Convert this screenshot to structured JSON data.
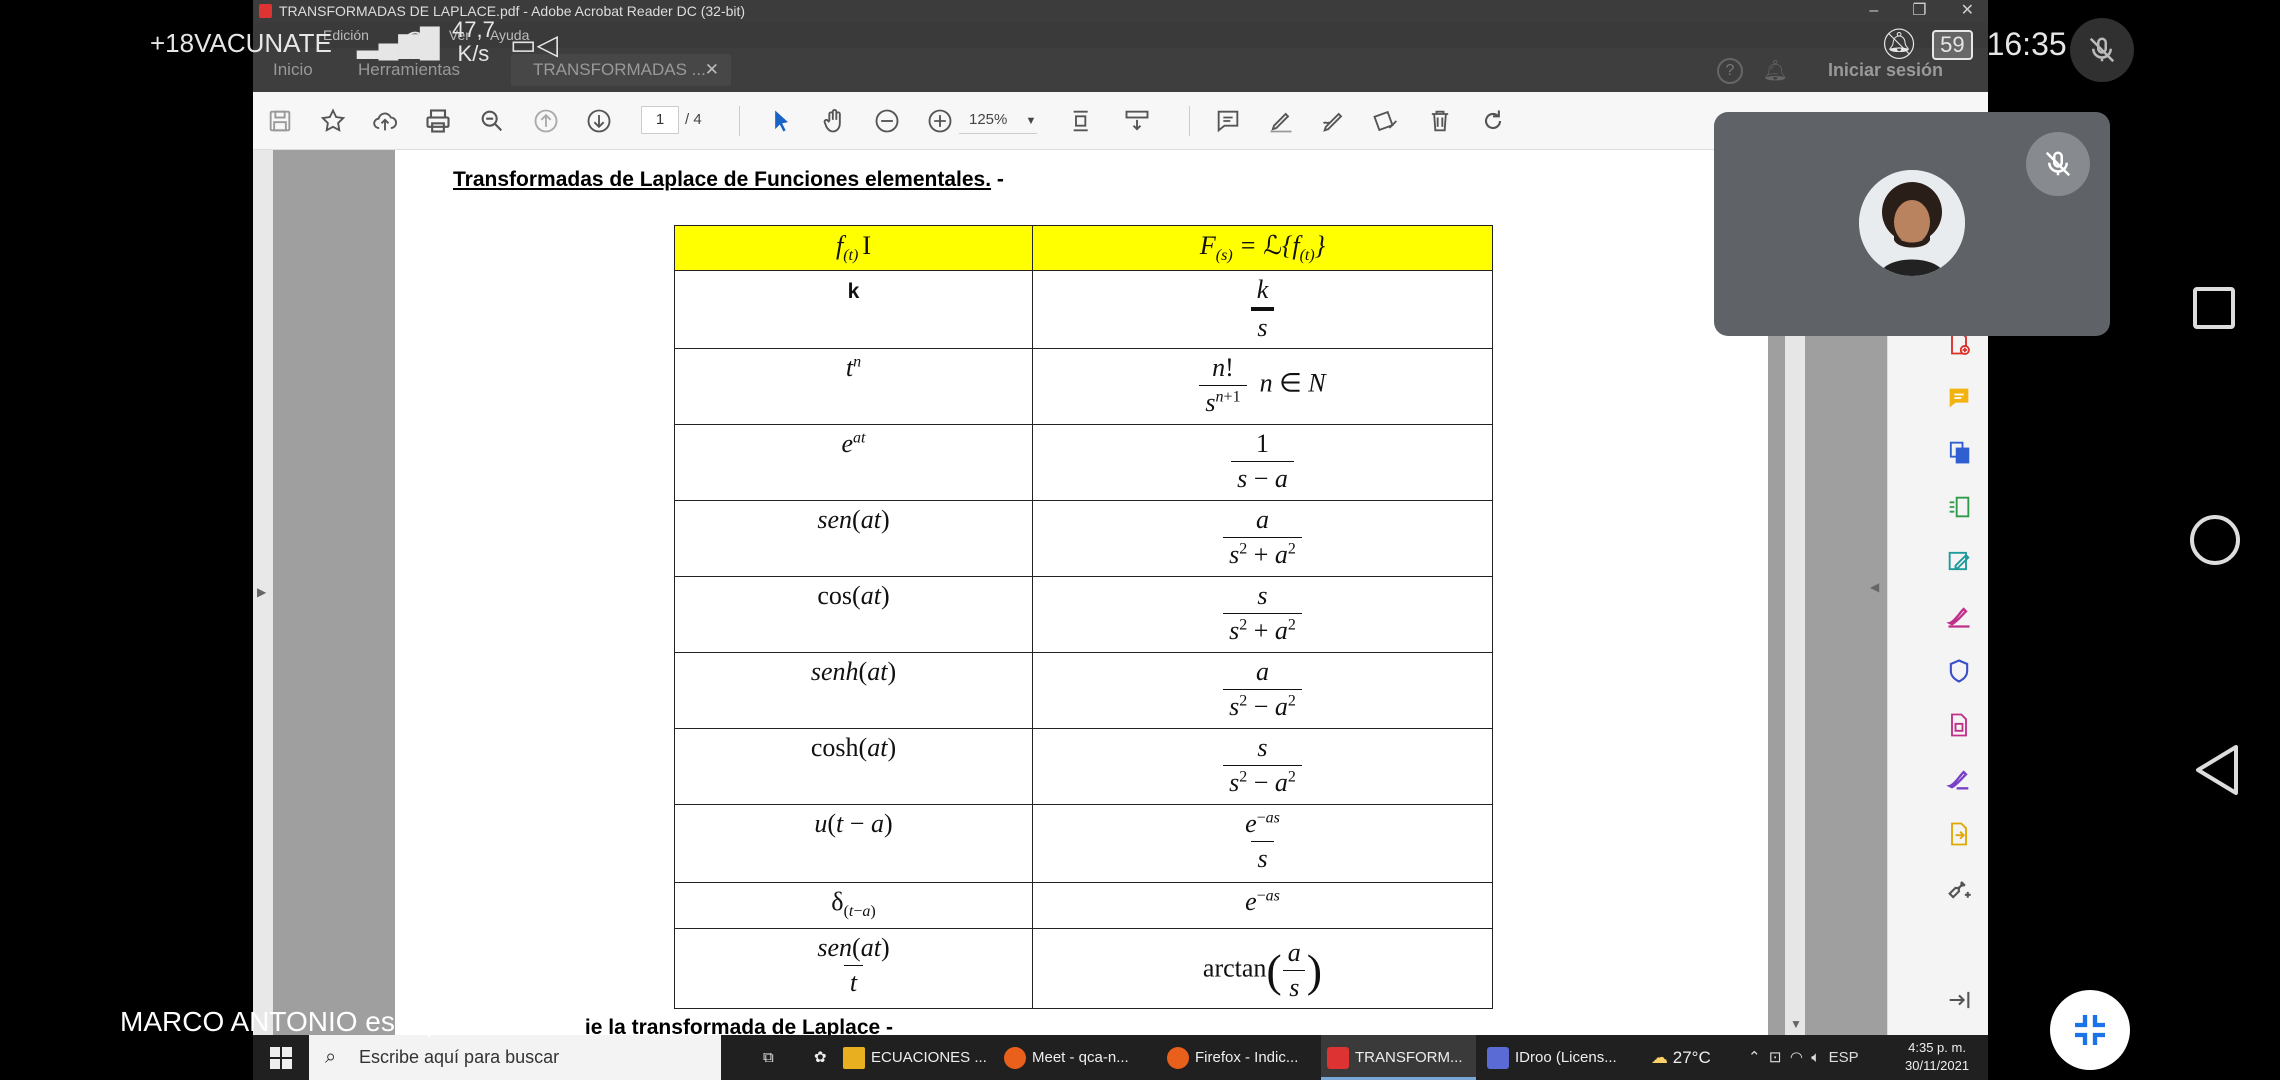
{
  "android": {
    "carrier": "+18VACUNATE",
    "net_speed_value": "47,7",
    "net_speed_unit": "K/s",
    "battery": "59",
    "time": "16:35"
  },
  "acrobat": {
    "window_title": "TRANSFORMADAS DE LAPLACE.pdf - Adobe Acrobat Reader DC (32-bit)",
    "menu": [
      "Edición",
      "Ver",
      "Ayuda"
    ],
    "tabs": {
      "home": "Inicio",
      "tools": "Herramientas",
      "document": "TRANSFORMADAS ..."
    },
    "sign_in": "Iniciar sesión",
    "page_current": "1",
    "page_total": "/ 4",
    "zoom": "125%"
  },
  "document": {
    "heading": "Transformadas de Laplace de Funciones elementales.",
    "heading_suffix": " -",
    "heading2": "ie la transformada de Laplace -",
    "table": {
      "rows": [
        {
          "f": "k",
          "F": "k / s"
        },
        {
          "f": "t^n",
          "F": "n! / s^(n+1)  n ∈ N"
        },
        {
          "f": "e^(at)",
          "F": "1 / (s − a)"
        },
        {
          "f": "sen(at)",
          "F": "a / (s² + a²)"
        },
        {
          "f": "cos(at)",
          "F": "s / (s² + a²)"
        },
        {
          "f": "senh(at)",
          "F": "a / (s² − a²)"
        },
        {
          "f": "cosh(at)",
          "F": "s / (s² − a²)"
        },
        {
          "f": "u(t − a)",
          "F": "e^(−as) / s"
        },
        {
          "f": "δ(t−a)",
          "F": "e^(−as)"
        },
        {
          "f": "sen(at) / t",
          "F": "arctan(a / s)"
        }
      ]
    }
  },
  "taskbar": {
    "search_placeholder": "Escribe aquí para buscar",
    "apps": [
      "ECUACIONES ...",
      "Meet - qca-n...",
      "Firefox - Indic...",
      "TRANSFORM...",
      "IDroo (Licens..."
    ],
    "weather": "27°C",
    "lang": "ESP",
    "clock_time": "4:35 p. m.",
    "clock_date": "30/11/2021"
  },
  "meet": {
    "presenting": "MARCO ANTONIO está presentando"
  }
}
